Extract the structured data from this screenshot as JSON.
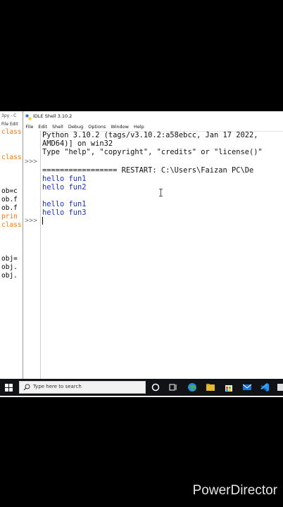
{
  "background_editor": {
    "title": "3py - C",
    "menu": "File  Edit",
    "code_lines": [
      {
        "text": "class",
        "color": "kw"
      },
      {
        "text": "",
        "color": "nm"
      },
      {
        "text": "",
        "color": "nm"
      },
      {
        "text": "class",
        "color": "kw"
      },
      {
        "text": "",
        "color": "nm"
      },
      {
        "text": "",
        "color": "nm"
      },
      {
        "text": "",
        "color": "nm"
      },
      {
        "text": "ob=c",
        "color": "nm"
      },
      {
        "text": "ob.f",
        "color": "nm"
      },
      {
        "text": "ob.f",
        "color": "nm"
      },
      {
        "text": "prin",
        "color": "kw"
      },
      {
        "text": "class",
        "color": "kw"
      },
      {
        "text": "",
        "color": "nm"
      },
      {
        "text": "",
        "color": "nm"
      },
      {
        "text": "",
        "color": "nm"
      },
      {
        "text": "obj=",
        "color": "nm"
      },
      {
        "text": "obj.",
        "color": "nm"
      },
      {
        "text": "obj.",
        "color": "nm"
      }
    ]
  },
  "shell": {
    "title": "IDLE Shell 3.10.2",
    "menu": [
      "File",
      "Edit",
      "Shell",
      "Debug",
      "Options",
      "Window",
      "Help"
    ],
    "prompt_symbol": ">>>",
    "lines": [
      {
        "text": "Python 3.10.2 (tags/v3.10.2:a58ebcc, Jan 17 2022,",
        "color": "black"
      },
      {
        "text": "AMD64)] on win32",
        "color": "black"
      },
      {
        "text": "Type \"help\", \"copyright\", \"credits\" or \"license()\"",
        "color": "black"
      },
      {
        "text": "",
        "color": "black"
      },
      {
        "text": "================= RESTART: C:\\Users\\Faizan PC\\De",
        "color": "black"
      },
      {
        "text": "hello fun1",
        "color": "blue"
      },
      {
        "text": "hello fun2",
        "color": "blue"
      },
      {
        "text": "",
        "color": "black"
      },
      {
        "text": "hello fun1",
        "color": "blue"
      },
      {
        "text": "hello fun3",
        "color": "blue"
      }
    ]
  },
  "taskbar": {
    "search_placeholder": "Type here to search"
  },
  "watermark": "PowerDirector",
  "colors": {
    "keyword": "#ff7700",
    "output_blue": "#1a32c8",
    "taskbar": "#101216"
  }
}
